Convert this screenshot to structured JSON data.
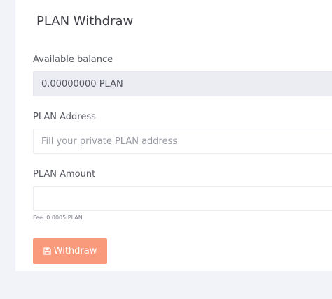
{
  "form": {
    "title": "PLAN Withdraw",
    "balance_label": "Available balance",
    "balance_value": "0.00000000 PLAN",
    "address_label": "PLAN Address",
    "address_placeholder": "Fill your private PLAN address",
    "address_value": "",
    "amount_label": "PLAN Amount",
    "amount_value": "",
    "fee_text": "Fee: 0.0005 PLAN",
    "submit_label": "Withdraw",
    "submit_icon": "save-icon"
  },
  "colors": {
    "page_bg": "#f2f3f8",
    "card_bg": "#ffffff",
    "readonly_bg": "#ebedf2",
    "button_bg": "#f99a7c",
    "text": "#575962"
  }
}
